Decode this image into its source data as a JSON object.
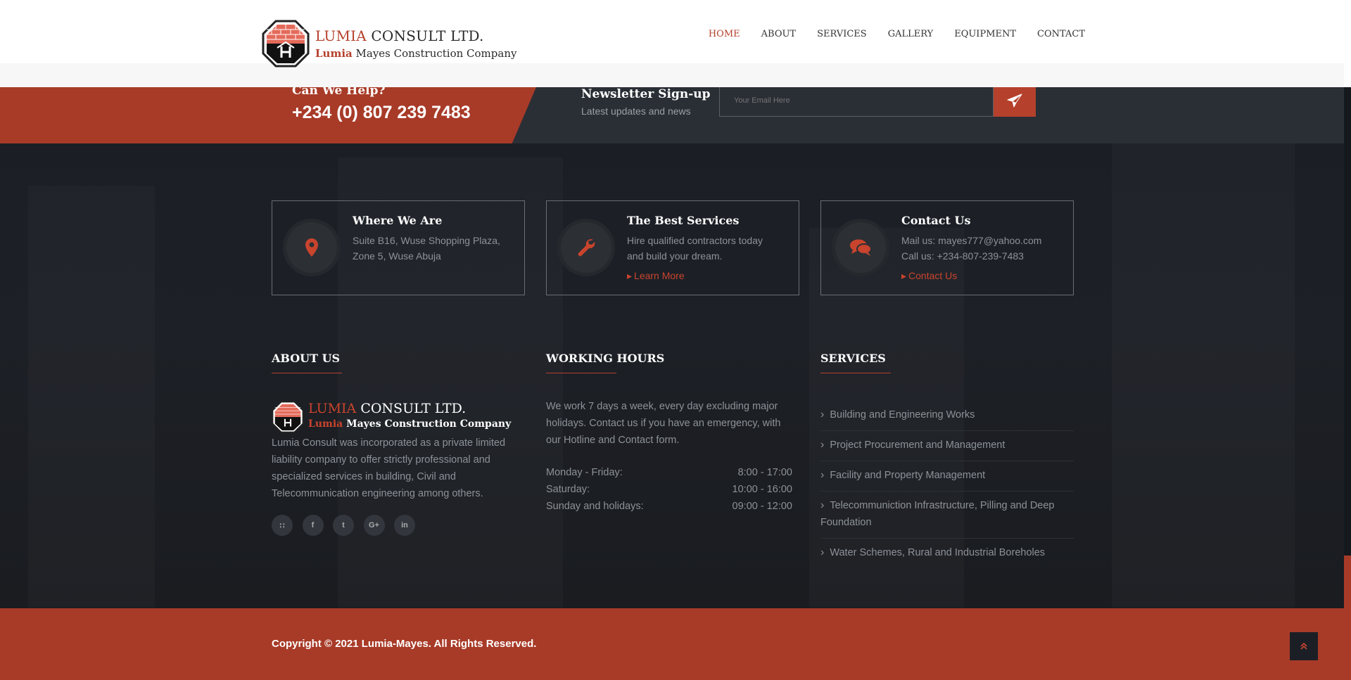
{
  "header": {
    "logo": {
      "line1_accent": "LUMIA",
      "line1_rest": " CONSULT LTD.",
      "line2_accent": "Lumia",
      "line2_rest": " Mayes Construction Company"
    },
    "nav": [
      {
        "label": "HOME",
        "active": true
      },
      {
        "label": "ABOUT"
      },
      {
        "label": "SERVICES"
      },
      {
        "label": "GALLERY"
      },
      {
        "label": "EQUIPMENT"
      },
      {
        "label": "CONTACT"
      }
    ]
  },
  "help": {
    "title": "Can We Help?",
    "phone": "+234 (0) 807 239 7483"
  },
  "newsletter": {
    "title": "Newsletter Sign-up",
    "subtitle": "Latest updates and news",
    "placeholder": "Your Email Here",
    "submit_icon": "paper-plane-icon"
  },
  "cards": [
    {
      "icon": "map-marker-icon",
      "title": "Where We Are",
      "lines": [
        "Suite B16, Wuse Shopping Plaza,",
        "Zone 5, Wuse Abuja"
      ],
      "link": ""
    },
    {
      "icon": "wrench-icon",
      "title": "The Best Services",
      "lines": [
        "Hire qualified contractors today",
        "and build your dream."
      ],
      "link": "Learn More"
    },
    {
      "icon": "comments-icon",
      "title": "Contact Us",
      "lines": [
        "Mail us: mayes777@yahoo.com",
        "Call us: +234-807-239-7483"
      ],
      "link": "Contact Us"
    }
  ],
  "about": {
    "title": "ABOUT US",
    "logo": {
      "line1_accent": "LUMIA",
      "line1_rest": " CONSULT LTD.",
      "line2_accent": "Lumia",
      "line2_rest": " Mayes Construction Company"
    },
    "text": "Lumia Consult was incorporated as a private limited liability company to offer strictly professional and specialized services in building, Civil and Telecommunication engineering among others.",
    "socials": [
      {
        "icon": "rss-icon",
        "glyph": "∷"
      },
      {
        "icon": "facebook-icon",
        "glyph": "f"
      },
      {
        "icon": "twitter-icon",
        "glyph": "t"
      },
      {
        "icon": "google-plus-icon",
        "glyph": "G+"
      },
      {
        "icon": "linkedin-icon",
        "glyph": "in"
      }
    ]
  },
  "hours": {
    "title": "WORKING HOURS",
    "text": "We work 7 days a week, every day excluding major holidays. Contact us if you have an emergency, with our Hotline and Contact form.",
    "rows": [
      {
        "day": "Monday - Friday:",
        "time": "8:00 - 17:00"
      },
      {
        "day": "Saturday:",
        "time": "10:00 - 16:00"
      },
      {
        "day": "Sunday and holidays:",
        "time": "09:00 - 12:00"
      }
    ]
  },
  "services": {
    "title": "SERVICES",
    "items": [
      "Building and Engineering Works",
      "Project Procurement and Management",
      "Facility and Property Management",
      "Telecommuniction Infrastructure, Pilling and Deep Foundation",
      "Water Schemes, Rural and Industrial Boreholes"
    ]
  },
  "footer": {
    "copyright": "Copyright © 2021 Lumia-Mayes. All Rights Reserved.",
    "top_icon": "chevron-double-up-icon"
  },
  "colors": {
    "accent": "#b5412c",
    "dark": "#1b1f25",
    "band": "#2a2e35"
  }
}
